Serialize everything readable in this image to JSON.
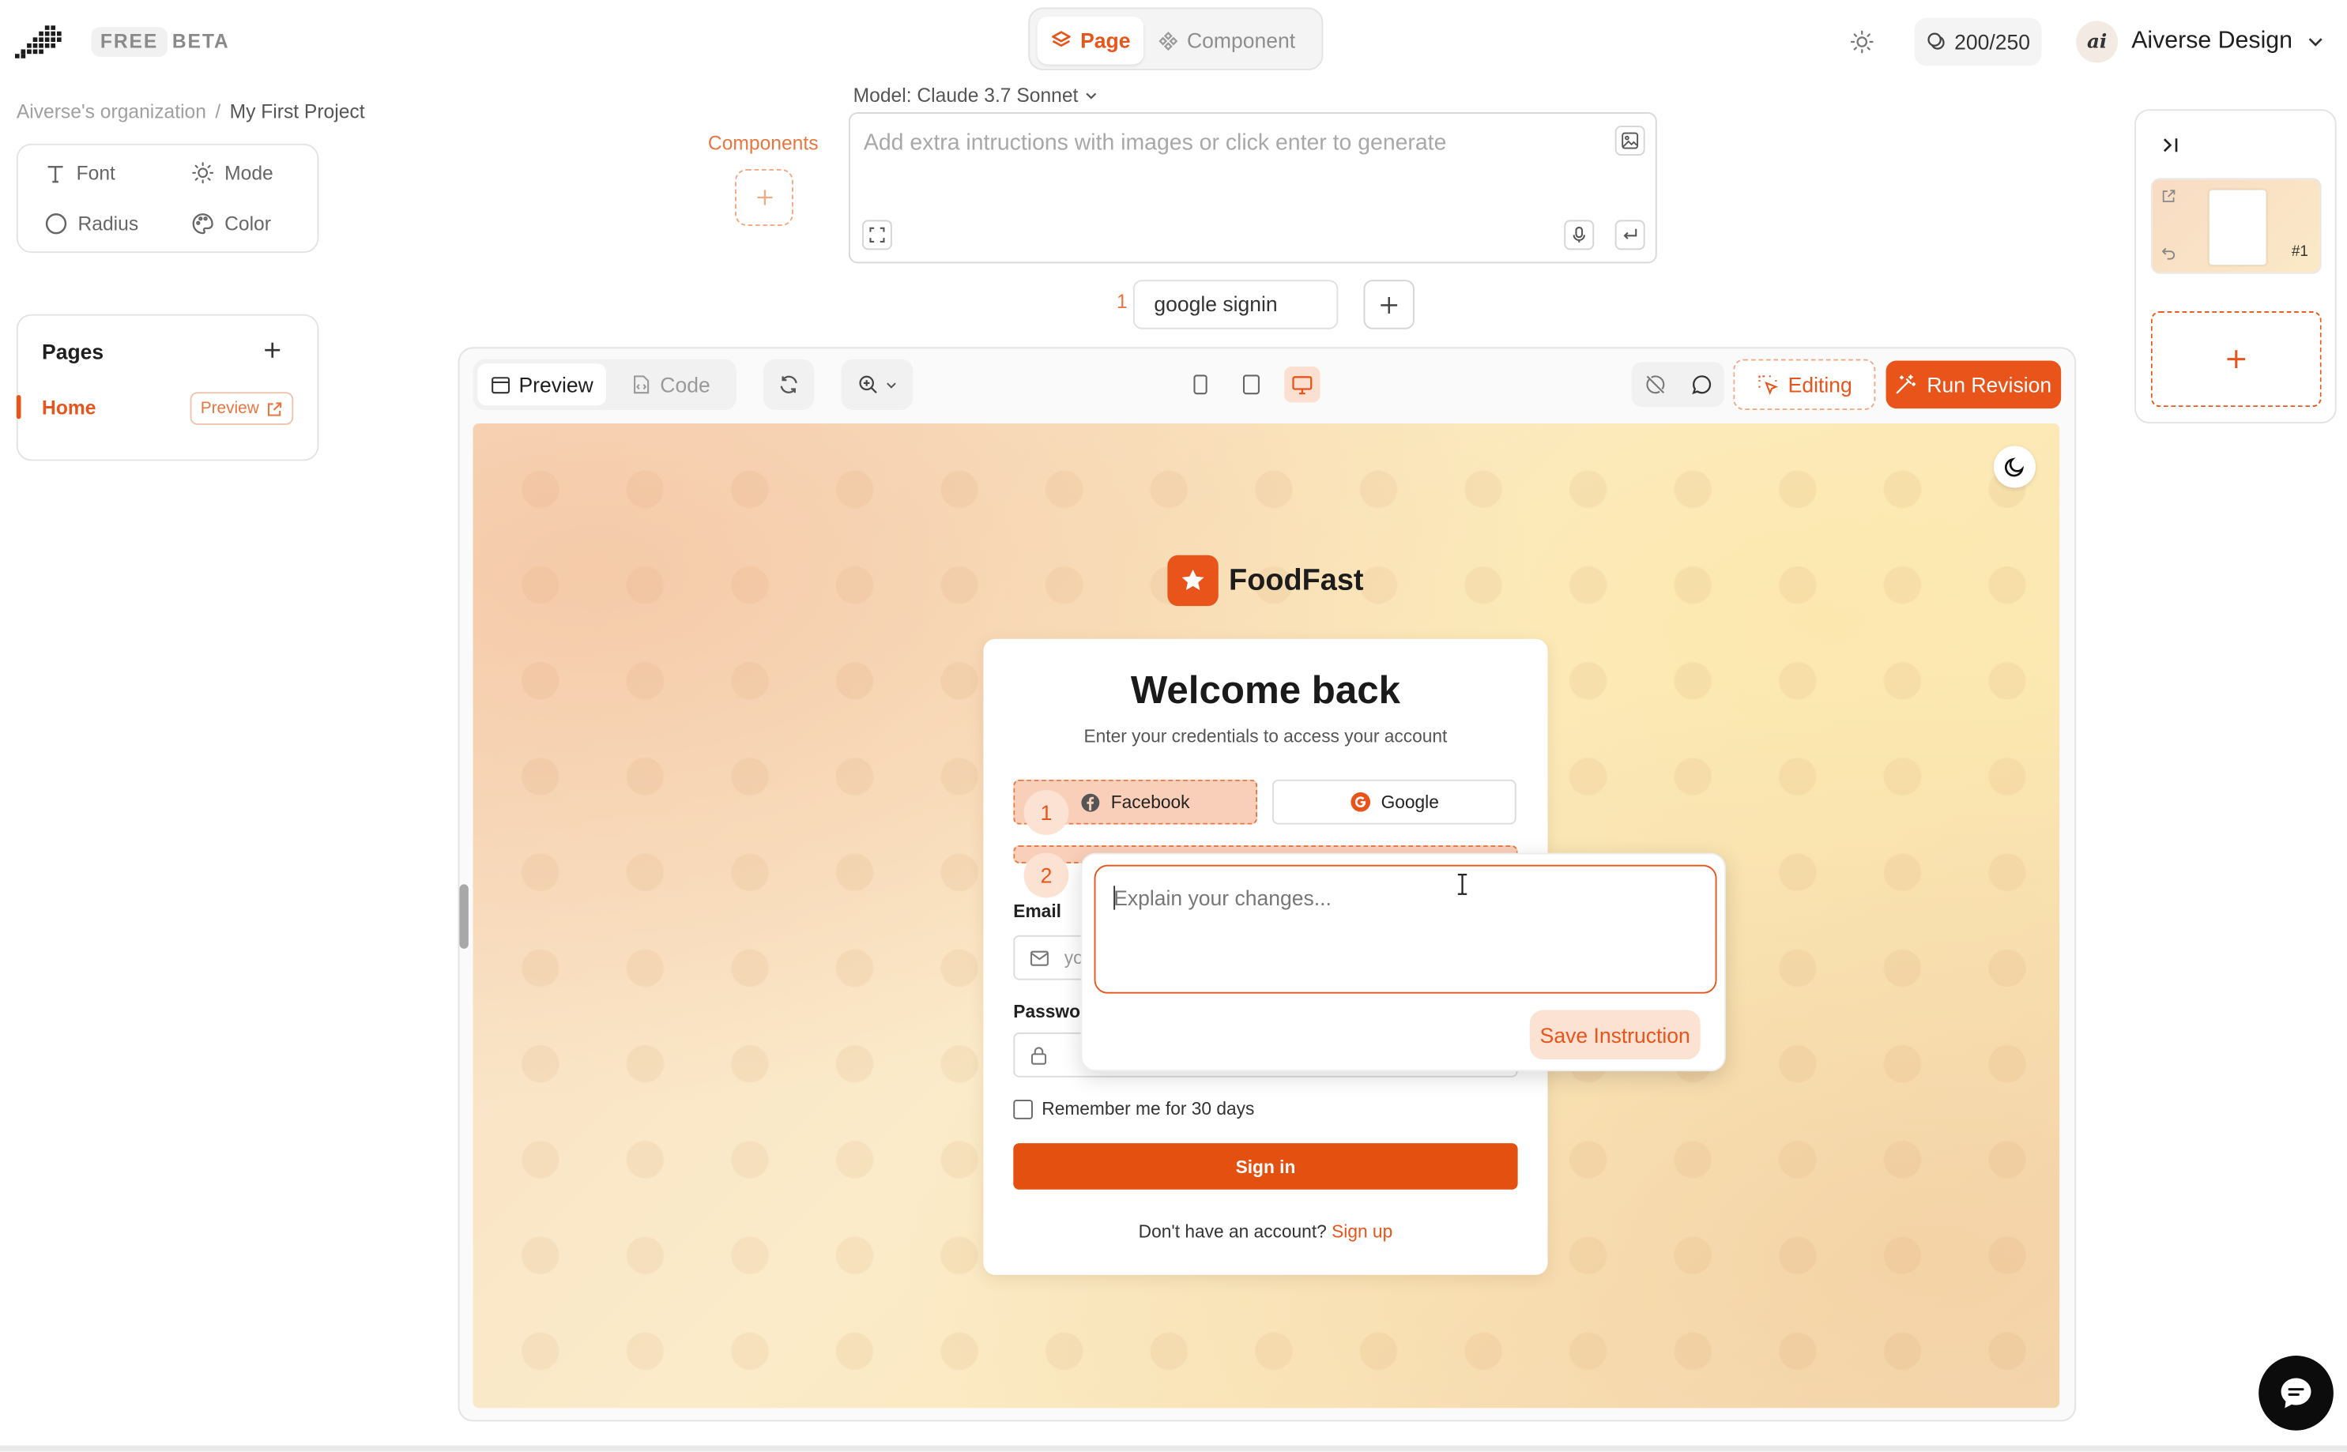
{
  "topbar": {
    "badge_free": "FREE",
    "badge_beta": "BETA",
    "mode_tabs": {
      "page": "Page",
      "component": "Component",
      "active": "page"
    },
    "credits": "200/250",
    "user_initials": "ai",
    "user_name": "Aiverse Design"
  },
  "breadcrumb": {
    "org": "Aiverse's organization",
    "separator": "/",
    "project": "My First Project"
  },
  "style_panel": {
    "font": "Font",
    "mode": "Mode",
    "radius": "Radius",
    "color": "Color"
  },
  "pages_panel": {
    "title": "Pages",
    "items": [
      {
        "label": "Home",
        "preview_label": "Preview",
        "active": true
      }
    ]
  },
  "components": {
    "label": "Components"
  },
  "prompt": {
    "model": "Model: Claude 3.7 Sonnet",
    "placeholder": "Add extra intructions with images or click enter to generate"
  },
  "chips": [
    {
      "number": "1",
      "label": "google signin"
    }
  ],
  "toolbar": {
    "preview": "Preview",
    "code": "Code",
    "editing": "Editing",
    "run_revision": "Run Revision",
    "active_device": "desktop"
  },
  "preview_app": {
    "brand": "FoodFast",
    "title": "Welcome back",
    "subtitle": "Enter your credentials to access your account",
    "facebook": "Facebook",
    "google": "Google",
    "marker_1": "1",
    "marker_2": "2",
    "email_label": "Email",
    "email_placeholder_visible": "yo",
    "password_label": "Passwor",
    "remember": "Remember me for 30 days",
    "signin": "Sign in",
    "signup_prompt": "Don't have an account?",
    "signup_link": "Sign up"
  },
  "popover": {
    "placeholder": "Explain your changes...",
    "save": "Save Instruction"
  },
  "right_panel": {
    "thumb_badge": "#1"
  },
  "colors": {
    "accent": "#e8541a",
    "accent_light": "#fbe2d3",
    "signin": "#e4500f"
  }
}
